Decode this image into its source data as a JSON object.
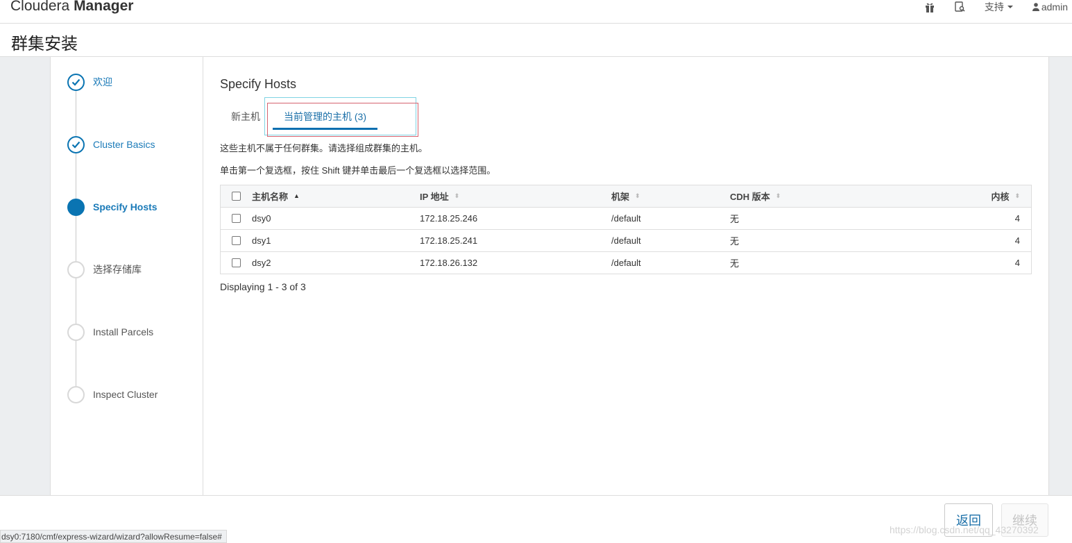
{
  "app": {
    "brand_light": "Cloudera ",
    "brand_bold": "Manager",
    "support_label": "支持",
    "user_label": "admin",
    "icons": [
      "gift-icon",
      "clipboard-search-icon",
      "caret-down-icon",
      "user-icon"
    ]
  },
  "page": {
    "title": "群集安装"
  },
  "wizard": {
    "steps": [
      {
        "label": "欢迎",
        "state": "done"
      },
      {
        "label": "Cluster Basics",
        "state": "done"
      },
      {
        "label": "Specify Hosts",
        "state": "active"
      },
      {
        "label": "选择存储库",
        "state": "pending"
      },
      {
        "label": "Install Parcels",
        "state": "pending"
      },
      {
        "label": "Inspect Cluster",
        "state": "pending"
      }
    ]
  },
  "main": {
    "title": "Specify Hosts",
    "tabs": [
      {
        "label": "新主机",
        "selected": false
      },
      {
        "label": "当前管理的主机 (3)",
        "selected": true
      }
    ],
    "help_line1": "这些主机不属于任何群集。请选择组成群集的主机。",
    "help_line2": "单击第一个复选框，按住 Shift 键并单击最后一个复选框以选择范围。",
    "table": {
      "columns": [
        "主机名称",
        "IP 地址",
        "机架",
        "CDH 版本",
        "内核"
      ],
      "sorted_column": "主机名称",
      "rows": [
        {
          "name": "dsy0",
          "ip": "172.18.25.246",
          "rack": "/default",
          "cdh": "无",
          "cores": "4"
        },
        {
          "name": "dsy1",
          "ip": "172.18.25.241",
          "rack": "/default",
          "cdh": "无",
          "cores": "4"
        },
        {
          "name": "dsy2",
          "ip": "172.18.26.132",
          "rack": "/default",
          "cdh": "无",
          "cores": "4"
        }
      ]
    },
    "paging": "Displaying 1 - 3 of 3"
  },
  "footer": {
    "back_label": "返回",
    "next_label": "继续",
    "status_url": "dsy0:7180/cmf/express-wizard/wizard?allowResume=false#",
    "watermark": "https://blog.csdn.net/qq_43270392"
  },
  "colors": {
    "accent": "#0a74b2",
    "link": "#1a7ab8",
    "background": "#eceef0"
  }
}
